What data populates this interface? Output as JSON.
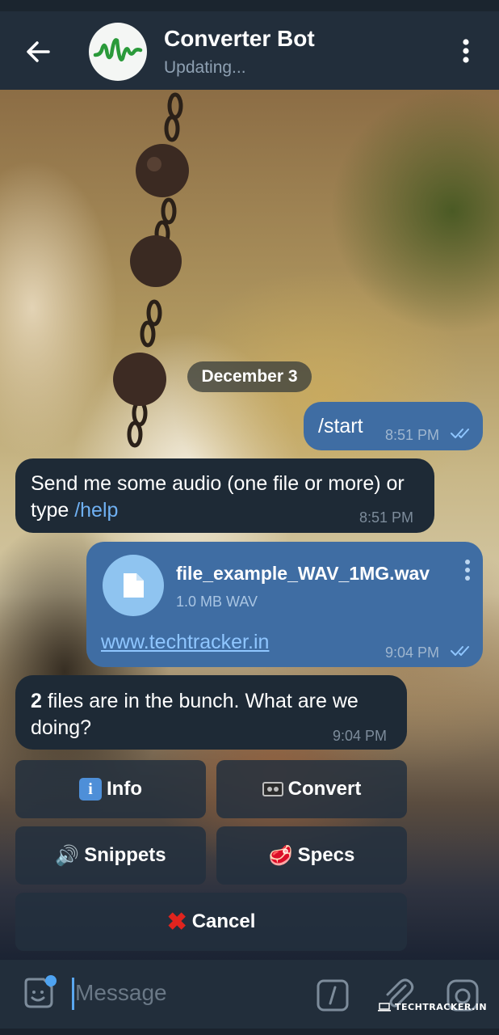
{
  "header": {
    "title": "Converter Bot",
    "status": "Updating...",
    "icons": {
      "back": "arrow-left-icon",
      "menu": "more-vertical-icon",
      "avatar": "waveform-logo"
    }
  },
  "chat": {
    "date_label": "December 3",
    "messages": [
      {
        "direction": "outgoing",
        "text": "/start",
        "time": "8:51 PM",
        "status": "read"
      },
      {
        "direction": "incoming",
        "text": "Send me some audio (one file or more) or type ",
        "link": "/help",
        "time": "8:51 PM"
      },
      {
        "direction": "outgoing",
        "type": "file",
        "file_name": "file_example_WAV_1MG.wav",
        "file_meta": "1.0 MB WAV",
        "link": "www.techtracker.in",
        "time": "9:04 PM",
        "status": "read"
      },
      {
        "direction": "incoming",
        "prefix": "2",
        "text": " files are in the bunch. What are we doing?",
        "time": "9:04 PM"
      }
    ]
  },
  "keyboard": {
    "buttons": [
      {
        "label": "Info",
        "emoji": "i",
        "icon": "information-emoji"
      },
      {
        "label": "Convert",
        "icon": "videocassette-emoji"
      },
      {
        "label": "Snippets",
        "emoji": "🔊",
        "icon": "speaker-emoji"
      },
      {
        "label": "Specs",
        "emoji": "🥩",
        "icon": "cut-of-meat-emoji"
      },
      {
        "label": "Cancel",
        "emoji": "✖",
        "icon": "cross-mark-emoji"
      }
    ]
  },
  "input": {
    "placeholder": "Message",
    "icons": [
      "sticker-icon",
      "slash-command-icon",
      "attach-icon",
      "camera-icon"
    ]
  },
  "watermark": "TECHTRACKER.IN",
  "colors": {
    "header_bg": "#222e3b",
    "outgoing_bubble": "#3f6da3",
    "incoming_bubble": "#1e2a36",
    "link": "#6fb0f2",
    "accent": "#5aa7f0",
    "read_ticks": "#8fc6ff"
  }
}
